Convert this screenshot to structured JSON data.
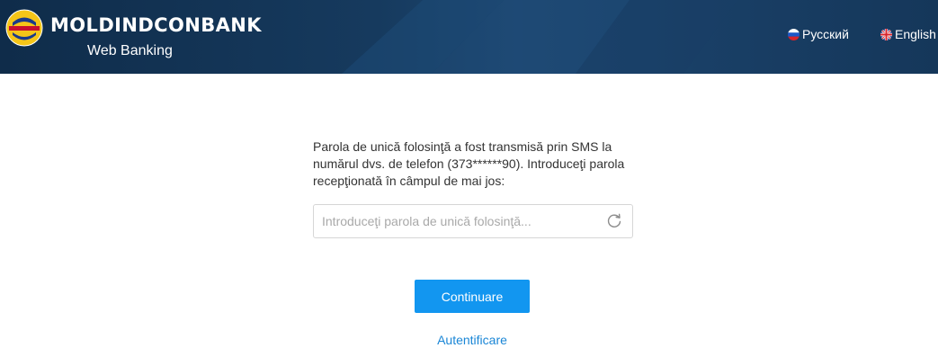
{
  "header": {
    "brand_name": "MOLDINDCONBANK",
    "brand_subtitle": "Web Banking",
    "logo_text": "MOLDINDCONBANK",
    "colors": {
      "background": "#163a5e",
      "text": "#ffffff"
    }
  },
  "languages": [
    {
      "label": "Русский",
      "flag": "russia-flag-icon"
    },
    {
      "label": "English",
      "flag": "uk-flag-icon"
    }
  ],
  "main": {
    "message": "Parola de unică folosinţă a fost transmisă prin SMS la numărul dvs. de telefon (373******90). Introduceţi parola recepţionată în câmpul de mai jos:",
    "otp_input": {
      "value": "",
      "placeholder": "Introduceţi parola de unică folosinţă..."
    },
    "refresh_icon": "refresh-icon",
    "continue_label": "Continuare",
    "auth_link_label": "Autentificare"
  },
  "colors": {
    "accent": "#1296f0",
    "link": "#1a86d6",
    "text": "#333333"
  }
}
